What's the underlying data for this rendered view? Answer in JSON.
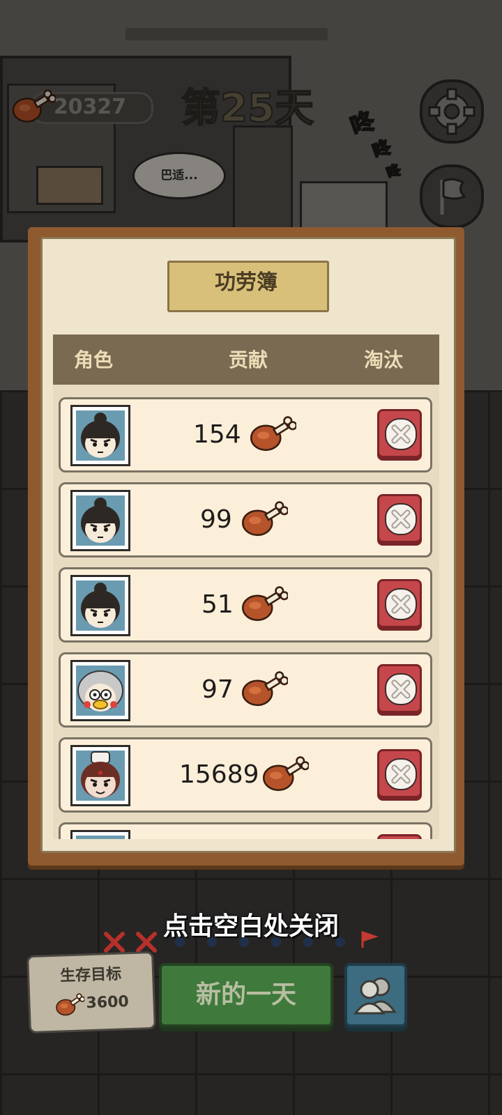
{
  "hud": {
    "food_total": "20327",
    "day": "第25天",
    "sound_effect": [
      "咚",
      "咚",
      "咚"
    ],
    "speech": "巴适...",
    "settings_icon": "gear-icon",
    "flag_icon": "white-flag-icon"
  },
  "modal": {
    "title": "功劳簿",
    "columns": [
      "角色",
      "贡献",
      "淘汰"
    ],
    "rows": [
      {
        "character": "bun-hair-survivor-avatar",
        "contribution": "154",
        "action": "remove"
      },
      {
        "character": "bun-hair-survivor-avatar",
        "contribution": "99",
        "action": "remove"
      },
      {
        "character": "bun-hair-survivor-avatar",
        "contribution": "51",
        "action": "remove"
      },
      {
        "character": "grey-hair-duck-face-avatar",
        "contribution": "97",
        "action": "remove"
      },
      {
        "character": "chef-hat-survivor-avatar",
        "contribution": "15689",
        "action": "remove"
      }
    ],
    "row_icon": "drumstick-icon",
    "remove_icon": "close-x-icon",
    "close_hint": "点击空白处关闭"
  },
  "bottom": {
    "goal_label": "生存目标",
    "goal_value": "3600",
    "new_day_label": "新的一天",
    "people_icon": "people-icon"
  },
  "colors": {
    "remove_button": "#c6474b",
    "new_day_button": "#3f7a3c",
    "people_button": "#3d6c80",
    "paper": "#efe5cc",
    "header": "#7a6a52"
  }
}
